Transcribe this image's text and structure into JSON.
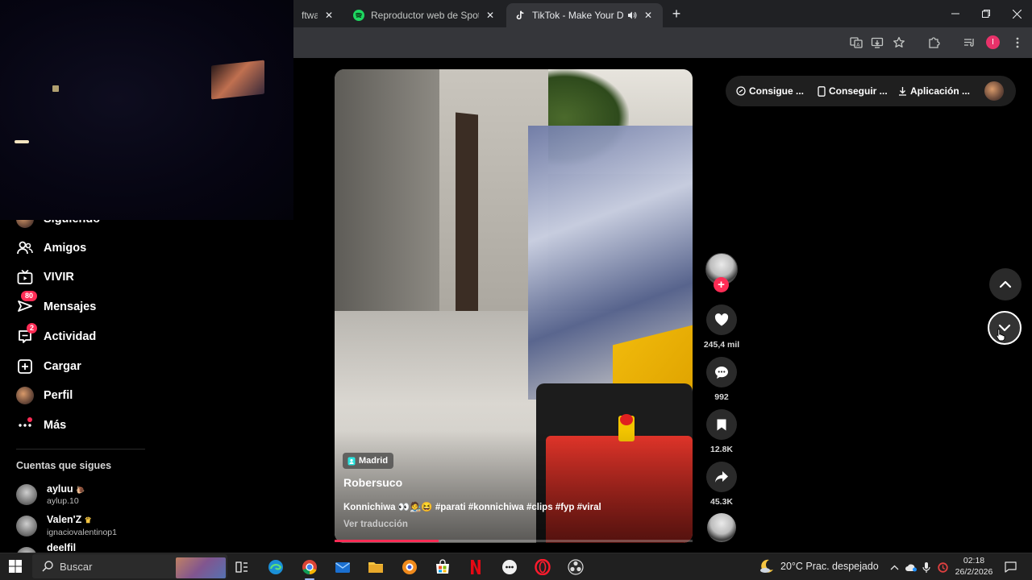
{
  "browser": {
    "tabs": [
      {
        "title": "ftware",
        "active": false
      },
      {
        "title": "Reproductor web de Spotify: m",
        "active": false
      },
      {
        "title": "TikTok - Make Your Day",
        "active": true
      }
    ]
  },
  "sidebar": {
    "following_partial": "Siguiendo",
    "items": [
      {
        "label": "Amigos",
        "icon": "friends-icon"
      },
      {
        "label": "VIVIR",
        "icon": "live-tv-icon"
      },
      {
        "label": "Mensajes",
        "icon": "messages-icon",
        "badge": "80"
      },
      {
        "label": "Actividad",
        "icon": "activity-icon",
        "badge": "2"
      },
      {
        "label": "Cargar",
        "icon": "upload-icon"
      },
      {
        "label": "Perfil",
        "icon": "profile-avatar"
      },
      {
        "label": "Más",
        "icon": "more-icon"
      }
    ],
    "following_section_title": "Cuentas que sigues",
    "accounts": [
      {
        "display": "ayluu",
        "handle": "aylup.10"
      },
      {
        "display": "Valen'Z",
        "handle": "ignaciovalentinop1"
      },
      {
        "display": "deelfil",
        "handle": ""
      }
    ]
  },
  "video": {
    "location": "Madrid",
    "author": "Robersuco",
    "caption": "Konnichiwa 👀🧑‍🎨😆 #parati #konnichiwa #clips #fyp #viral",
    "translate_label": "Ver traducción",
    "progress": 0.29
  },
  "actions": {
    "likes": "245,4 mil",
    "comments": "992",
    "saves": "12.8K",
    "shares": "45.3K"
  },
  "top_links": {
    "coins": "Consigue ...",
    "device": "Conseguir ...",
    "app": "Aplicación ..."
  },
  "taskbar": {
    "search_placeholder": "Buscar",
    "weather": "20°C  Prac. despejado",
    "time": "02:18",
    "date": "26/2/2026"
  },
  "colors": {
    "accent": "#fe2c55",
    "background": "#000000",
    "chrome": "#35363a"
  }
}
